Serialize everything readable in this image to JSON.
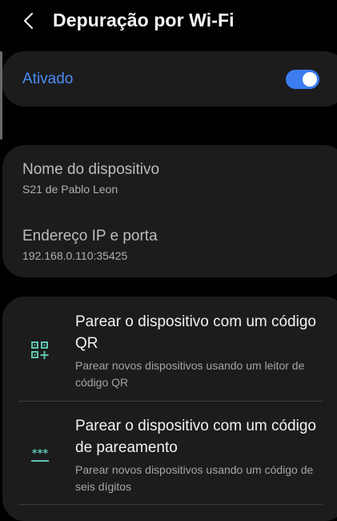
{
  "header": {
    "title": "Depuração por Wi-Fi",
    "back_icon": "chevron-left-icon"
  },
  "toggle": {
    "label": "Ativado",
    "state": "on",
    "accent_color": "#4a8cf6"
  },
  "device": {
    "name_label": "Nome do dispositivo",
    "name_value": "S21 de Pablo Leon",
    "ip_label": "Endereço IP e porta",
    "ip_value": "192.168.0.110:35425"
  },
  "pairing": {
    "items": [
      {
        "icon": "qr-code-icon",
        "title": "Parear o dispositivo com um código QR",
        "description": "Parear novos dispositivos usando um leitor de código QR"
      },
      {
        "icon": "pairing-code-icon",
        "title": "Parear o dispositivo com um código de pareamento",
        "description": "Parear novos dispositivos usando um código de seis dígitos"
      }
    ],
    "icon_color": "#5ec4b1"
  }
}
